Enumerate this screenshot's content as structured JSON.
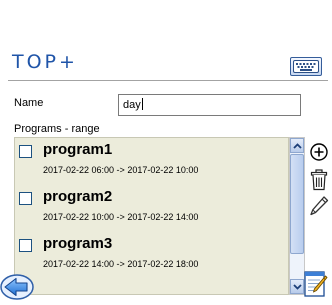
{
  "app": {
    "title": "TOP+"
  },
  "form": {
    "name_label": "Name",
    "name_value": "day",
    "programs_label": "Programs - range"
  },
  "programs": [
    {
      "name": "program1",
      "range": "2017-02-22 06:00 -> 2017-02-22 10:00",
      "checked": false
    },
    {
      "name": "program2",
      "range": "2017-02-22 10:00 -> 2017-02-22 14:00",
      "checked": false
    },
    {
      "name": "program3",
      "range": "2017-02-22 14:00 -> 2017-02-22 18:00",
      "checked": false
    }
  ],
  "icons": {
    "keyboard": "keyboard-icon",
    "add": "add-circle-icon",
    "delete": "trash-icon",
    "edit": "pencil-icon",
    "back": "back-arrow-icon",
    "save_edit": "notepad-edit-icon",
    "scroll_up": "chevron-up-icon",
    "scroll_down": "chevron-down-icon"
  },
  "colors": {
    "title": "#1f54a8",
    "list_background": "#ececdb",
    "accent": "#2f7fd8"
  }
}
